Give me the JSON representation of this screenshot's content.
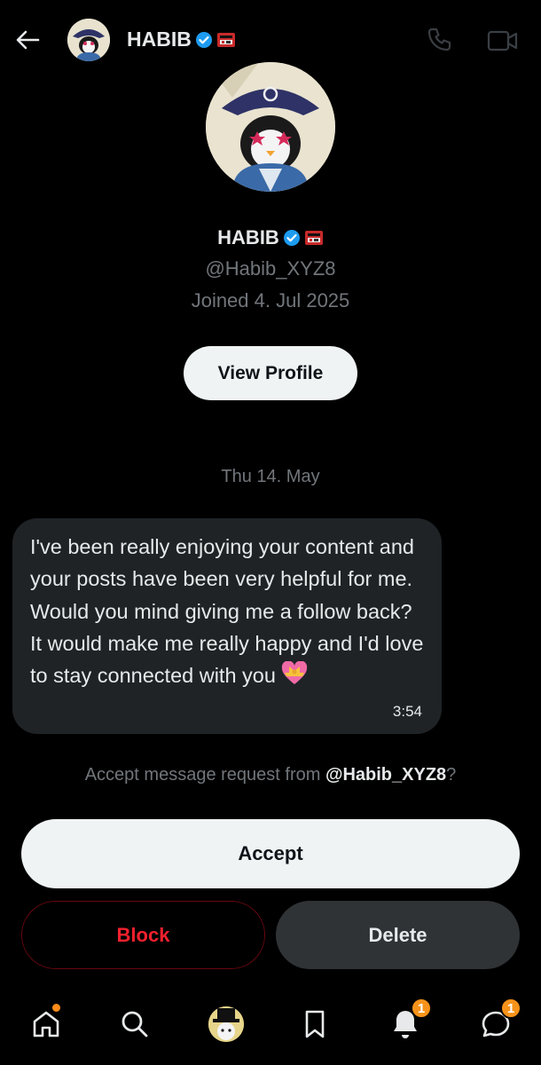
{
  "header": {
    "title": "HABIB",
    "icons": [
      "back-arrow-icon",
      "verified-badge-icon",
      "affiliate-flag-icon",
      "phone-icon",
      "video-camera-icon"
    ]
  },
  "profile": {
    "name": "HABIB",
    "handle": "@Habib_XYZ8",
    "joined": "Joined 4. Jul 2025",
    "view_profile_label": "View Profile"
  },
  "conversation": {
    "date": "Thu 14. May",
    "message": {
      "text": "I've been really enjoying your content and your posts have been very helpful for me. Would you mind giving me a follow back? It would make me really happy and I'd love to stay connected with you",
      "emoji": "heart-with-ribbon-emoji",
      "time": "3:54"
    }
  },
  "request": {
    "prompt_prefix": "Accept message request from ",
    "prompt_handle": "@Habib_XYZ8",
    "prompt_suffix": "?",
    "accept_label": "Accept",
    "block_label": "Block",
    "delete_label": "Delete"
  },
  "nav": {
    "items": [
      "home-icon",
      "search-icon",
      "grok-avatar",
      "bookmark-icon",
      "notifications-icon",
      "messages-icon"
    ],
    "notifications_badge": "1",
    "messages_badge": "1"
  },
  "colors": {
    "background": "#000000",
    "bubble": "#1f2326",
    "muted_text": "#71767b",
    "verified_blue": "#1d9bf0",
    "block_red": "#f4212e",
    "badge_orange": "#f7931a"
  }
}
